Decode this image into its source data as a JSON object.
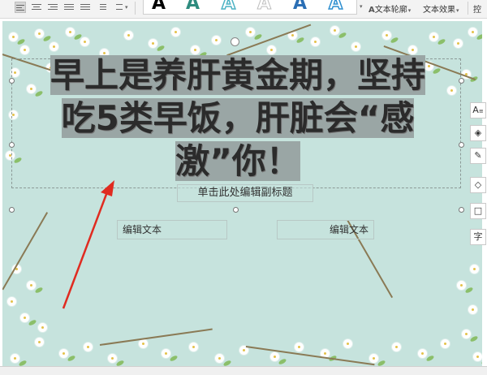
{
  "ribbon": {
    "align_buttons": [
      "align-left-icon",
      "align-center-icon",
      "align-right-icon",
      "justify-icon",
      "distribute-icon",
      "line-spacing-icon",
      "bullet-list-icon"
    ],
    "wordart_samples": [
      {
        "glyph": "A",
        "color": "#1f1f1f",
        "style": "solid"
      },
      {
        "glyph": "A",
        "color": "#2e8b7e",
        "style": "solid"
      },
      {
        "glyph": "A",
        "color": "#4db3c4",
        "style": "outline"
      },
      {
        "glyph": "A",
        "color": "#c8c8c8",
        "style": "outline"
      },
      {
        "glyph": "A",
        "color": "#2b6fb5",
        "style": "solid"
      },
      {
        "glyph": "A",
        "color": "#2e8fd0",
        "style": "outline"
      }
    ],
    "text_outline_label": "文本轮廓",
    "text_effect_label": "文本效果",
    "extra_label": "控"
  },
  "slide": {
    "title_lines": [
      "早上是养肝黄金期，坚持",
      "吃5类早饭，肝脏会“感",
      "激”你！"
    ],
    "subtitle_placeholder": "单击此处编辑副标题",
    "textbox_left": "编辑文本",
    "textbox_right": "编辑文本"
  },
  "float_toolbar": {
    "buttons": [
      "text-style-icon",
      "layers-icon",
      "edit-pen-icon",
      "fill-icon",
      "border-icon",
      "text-icon"
    ],
    "last_label": "字"
  }
}
